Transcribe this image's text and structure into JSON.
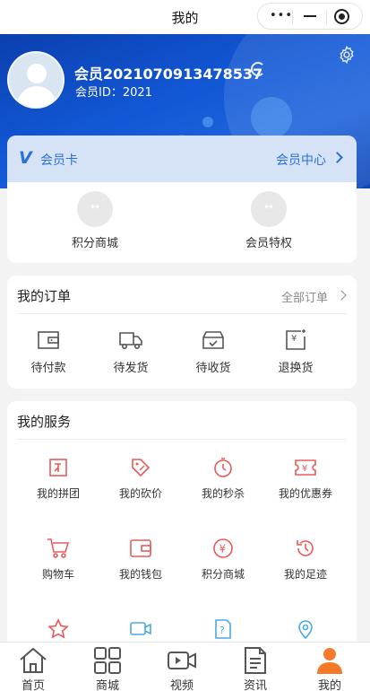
{
  "navbar": {
    "title": "我的"
  },
  "header": {
    "member_name": "会员2021070913478537",
    "member_id": "会员ID：2021"
  },
  "member_card": {
    "title": "会员卡",
    "center_link": "会员中心",
    "items": [
      {
        "label": "积分商城",
        "icon": "exchange-icon"
      },
      {
        "label": "会员特权",
        "icon": "exchange-icon"
      }
    ]
  },
  "orders": {
    "title": "我的订单",
    "all_link": "全部订单",
    "items": [
      {
        "label": "待付款",
        "icon": "wallet-icon"
      },
      {
        "label": "待发货",
        "icon": "truck-icon"
      },
      {
        "label": "待收货",
        "icon": "box-check-icon"
      },
      {
        "label": "退换货",
        "icon": "return-yen-icon"
      }
    ]
  },
  "services": {
    "title": "我的服务",
    "items": [
      {
        "label": "我的拼团",
        "icon": "group-buy-icon"
      },
      {
        "label": "我的砍价",
        "icon": "price-tag-icon"
      },
      {
        "label": "我的秒杀",
        "icon": "stopwatch-icon"
      },
      {
        "label": "我的优惠券",
        "icon": "coupon-icon"
      },
      {
        "label": "购物车",
        "icon": "cart-icon"
      },
      {
        "label": "我的钱包",
        "icon": "wallet-icon"
      },
      {
        "label": "积分商城",
        "icon": "yen-circle-icon"
      },
      {
        "label": "我的足迹",
        "icon": "history-icon"
      },
      {
        "label": "",
        "icon": "star-icon"
      },
      {
        "label": "",
        "icon": "video-chat-icon"
      },
      {
        "label": "",
        "icon": "help-doc-icon"
      },
      {
        "label": "",
        "icon": "location-icon"
      }
    ]
  },
  "tabbar": {
    "items": [
      {
        "label": "首页",
        "icon": "home-icon",
        "active": false
      },
      {
        "label": "商城",
        "icon": "grid-icon",
        "active": false
      },
      {
        "label": "视频",
        "icon": "video-icon",
        "active": false
      },
      {
        "label": "资讯",
        "icon": "document-icon",
        "active": false
      },
      {
        "label": "我的",
        "icon": "user-icon",
        "active": true
      }
    ]
  },
  "colors": {
    "brand_blue": "#1258d6",
    "service_red": "#e85a5a",
    "service_blue": "#4aa8e8",
    "tab_active": "#f47a2a"
  }
}
